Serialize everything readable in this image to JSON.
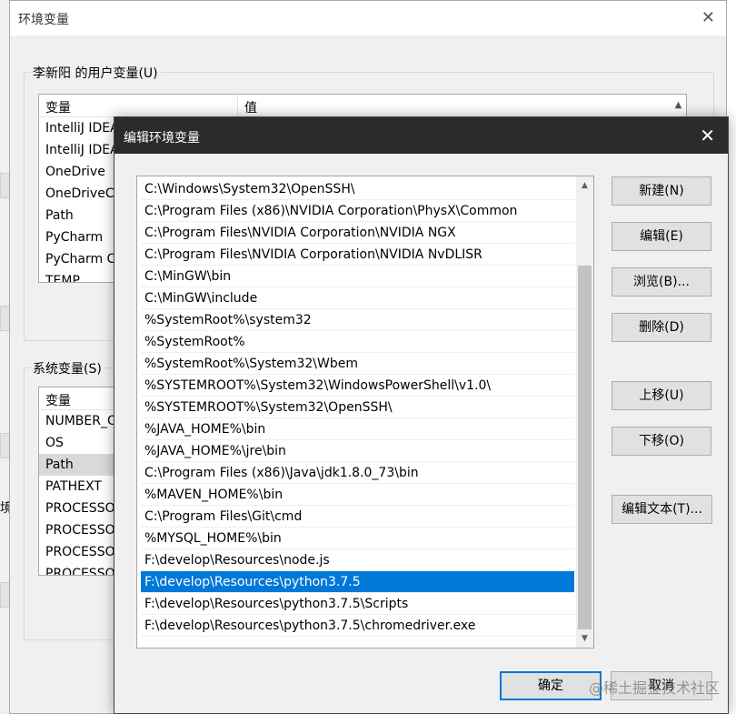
{
  "back_window": {
    "title": "环境变量",
    "user_group": {
      "legend": "李新阳 的用户变量(U)",
      "headers": [
        "变量",
        "值"
      ],
      "rows": [
        "IntelliJ IDEA",
        "IntelliJ IDEA",
        "OneDrive",
        "OneDriveC",
        "Path",
        "PyCharm",
        "PyCharm C",
        "TEMP"
      ]
    },
    "system_group": {
      "legend": "系统变量(S)",
      "header": "变量",
      "rows": [
        "NUMBER_OF",
        "OS",
        "Path",
        "PATHEXT",
        "PROCESSO",
        "PROCESSO",
        "PROCESSO",
        "PROCESSO"
      ]
    },
    "left_edge_text": "境"
  },
  "dialog": {
    "title": "编辑环境变量",
    "paths": [
      "C:\\Windows\\System32\\OpenSSH\\",
      "C:\\Program Files (x86)\\NVIDIA Corporation\\PhysX\\Common",
      "C:\\Program Files\\NVIDIA Corporation\\NVIDIA NGX",
      "C:\\Program Files\\NVIDIA Corporation\\NVIDIA NvDLISR",
      "C:\\MinGW\\bin",
      "C:\\MinGW\\include",
      "%SystemRoot%\\system32",
      "%SystemRoot%",
      "%SystemRoot%\\System32\\Wbem",
      "%SYSTEMROOT%\\System32\\WindowsPowerShell\\v1.0\\",
      "%SYSTEMROOT%\\System32\\OpenSSH\\",
      "%JAVA_HOME%\\bin",
      "%JAVA_HOME%\\jre\\bin",
      "C:\\Program Files (x86)\\Java\\jdk1.8.0_73\\bin",
      "%MAVEN_HOME%\\bin",
      "C:\\Program Files\\Git\\cmd",
      "%MYSQL_HOME%\\bin",
      "F:\\develop\\Resources\\node.js",
      "F:\\develop\\Resources\\python3.7.5",
      "F:\\develop\\Resources\\python3.7.5\\Scripts",
      "F:\\develop\\Resources\\python3.7.5\\chromedriver.exe"
    ],
    "selected_index": 18,
    "buttons": {
      "new": "新建(N)",
      "edit": "编辑(E)",
      "browse": "浏览(B)...",
      "delete": "删除(D)",
      "move_up": "上移(U)",
      "move_down": "下移(O)",
      "edit_text": "编辑文本(T)...",
      "ok": "确定",
      "cancel": "取消"
    }
  },
  "watermark": "@稀土掘金技术社区",
  "colors": {
    "selection": "#0078d7",
    "dialog_titlebar": "#2b2b2b"
  }
}
